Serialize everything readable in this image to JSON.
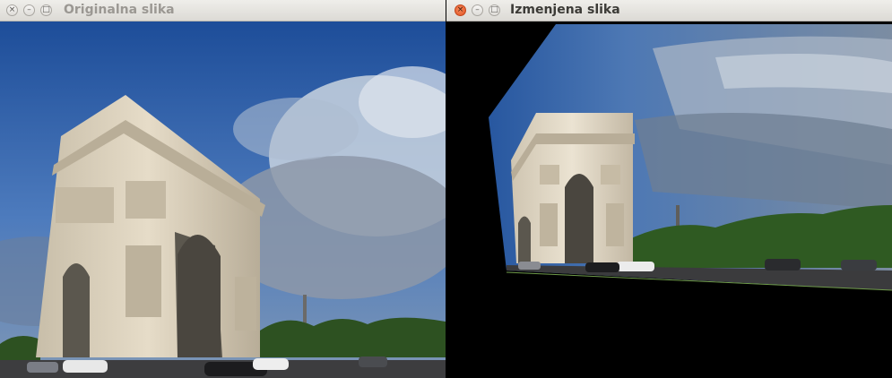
{
  "windows": [
    {
      "title": "Originalna slika",
      "focused": false,
      "buttons": {
        "close": "×",
        "minimize": "–",
        "maximize": "□"
      }
    },
    {
      "title": "Izmenjena slika",
      "focused": true,
      "buttons": {
        "close": "×",
        "minimize": "–",
        "maximize": "□"
      }
    }
  ],
  "colors": {
    "close_active": "#e9602d",
    "sky_top": "#1f4f9a",
    "sky_mid": "#4f7fc4",
    "stone": "#d6ccb8",
    "trees": "#2f5a22"
  }
}
